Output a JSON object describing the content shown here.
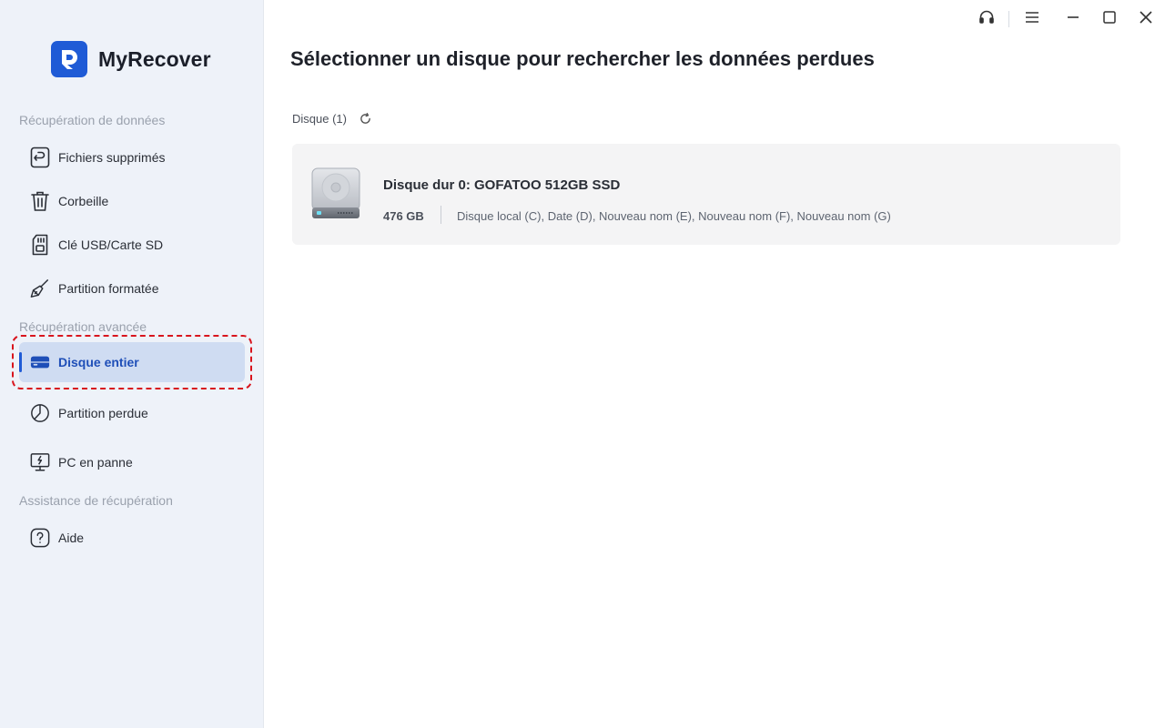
{
  "app": {
    "name": "MyRecover"
  },
  "titlebar": {
    "buttons": [
      "support-icon",
      "menu-icon",
      "minimize-icon",
      "maximize-icon",
      "close-icon"
    ]
  },
  "sidebar": {
    "sections": [
      {
        "label": "Récupération de données"
      },
      {
        "label": "Récupération avancée"
      },
      {
        "label": "Assistance de récupération"
      }
    ],
    "items": [
      {
        "label": "Fichiers supprimés",
        "icon": "restore-file-icon"
      },
      {
        "label": "Corbeille",
        "icon": "trash-icon"
      },
      {
        "label": "Clé USB/Carte SD",
        "icon": "sd-card-icon"
      },
      {
        "label": "Partition formatée",
        "icon": "broom-icon"
      },
      {
        "label": "Disque entier",
        "icon": "drive-icon",
        "active": true
      },
      {
        "label": "Partition perdue",
        "icon": "pie-partition-icon"
      },
      {
        "label": "PC en panne",
        "icon": "broken-pc-icon"
      },
      {
        "label": "Aide",
        "icon": "help-icon"
      }
    ]
  },
  "main": {
    "title": "Sélectionner un disque pour rechercher les données perdues",
    "disk_header": "Disque (1)",
    "disks": [
      {
        "name": "Disque dur 0: GOFATOO 512GB SSD",
        "size": "476 GB",
        "partitions": "Disque local (C), Date (D), Nouveau nom (E), Nouveau nom (F), Nouveau nom (G)"
      }
    ]
  },
  "colors": {
    "accent": "#1f5bd6",
    "sidebar_bg": "#eef2f9",
    "active_bg": "#cfdcf2",
    "highlight_frame": "#d8141d",
    "card_bg": "#f4f4f5"
  }
}
